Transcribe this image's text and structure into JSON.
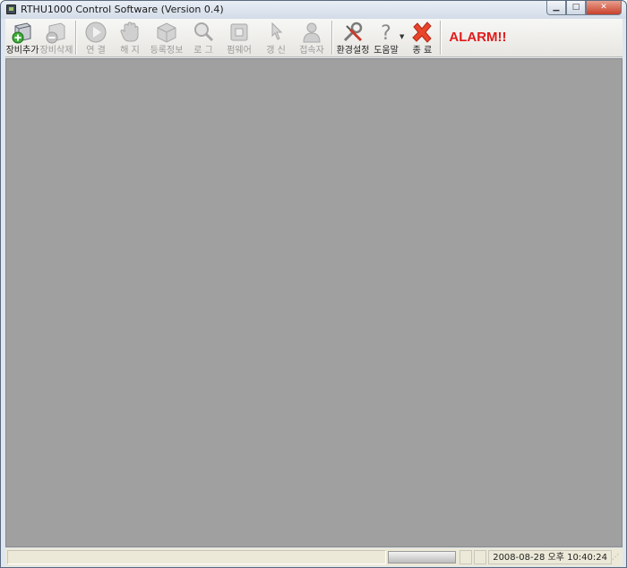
{
  "window": {
    "title": "RTHU1000 Control Software (Version 0.4)",
    "minimize_label": "▁",
    "maximize_label": "□",
    "close_label": "✕"
  },
  "toolbar": {
    "buttons": [
      {
        "label": "장비추가",
        "icon": "add-device-icon",
        "enabled": true
      },
      {
        "label": "장비삭제",
        "icon": "delete-device-icon",
        "enabled": false
      },
      {
        "label": "연 결",
        "icon": "connect-play-icon",
        "enabled": false
      },
      {
        "label": "해 지",
        "icon": "disconnect-hand-icon",
        "enabled": false
      },
      {
        "label": "등록정보",
        "icon": "registration-box-icon",
        "enabled": false
      },
      {
        "label": "로 그",
        "icon": "log-magnifier-icon",
        "enabled": false
      },
      {
        "label": "펌웨어",
        "icon": "firmware-chip-icon",
        "enabled": false
      },
      {
        "label": "갱 신",
        "icon": "refresh-pointer-icon",
        "enabled": false
      },
      {
        "label": "접속자",
        "icon": "user-icon",
        "enabled": false
      },
      {
        "label": "환경설정",
        "icon": "settings-tools-icon",
        "enabled": true
      },
      {
        "label": "도움말",
        "icon": "help-question-icon",
        "enabled": true
      },
      {
        "label": "종 료",
        "icon": "exit-x-icon",
        "enabled": true
      }
    ],
    "alarm_label": "ALARM!!",
    "alarm_color": "#e01b1b"
  },
  "statusbar": {
    "datetime": "2008-08-28 오후 10:40:24"
  },
  "colors": {
    "client_background": "#a0a0a0"
  }
}
